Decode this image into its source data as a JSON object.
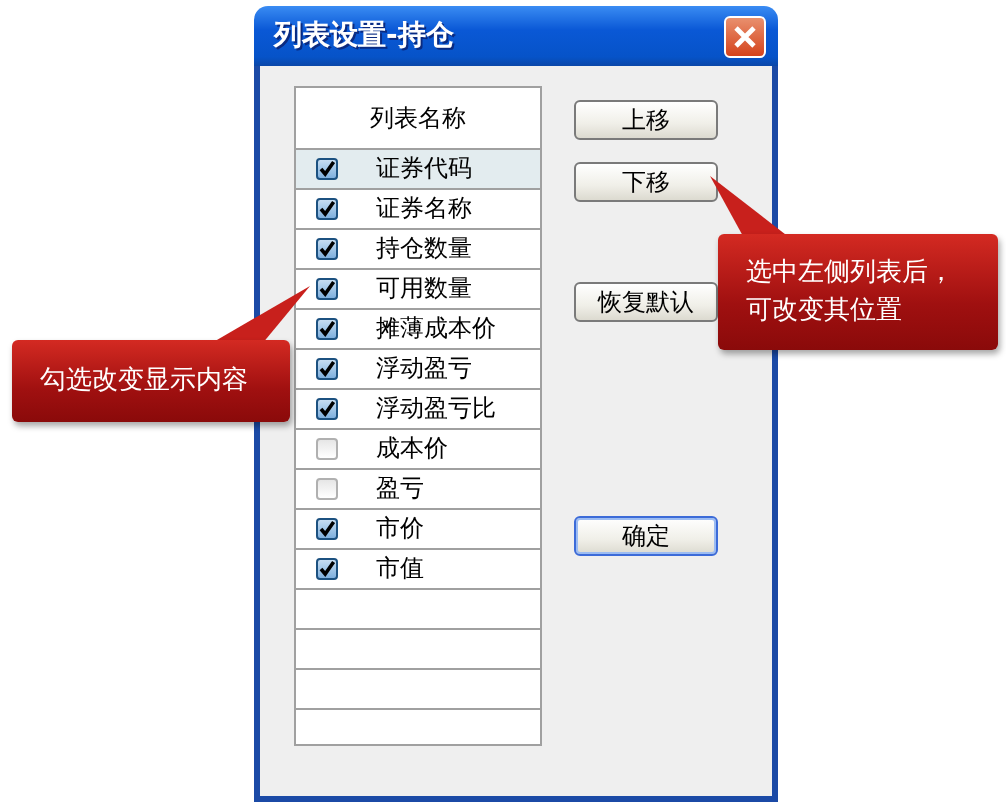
{
  "window": {
    "title": "列表设置-持仓"
  },
  "list": {
    "header": "列表名称",
    "items": [
      {
        "label": "证券代码",
        "checked": true,
        "selected": true
      },
      {
        "label": "证券名称",
        "checked": true,
        "selected": false
      },
      {
        "label": "持仓数量",
        "checked": true,
        "selected": false
      },
      {
        "label": "可用数量",
        "checked": true,
        "selected": false
      },
      {
        "label": "摊薄成本价",
        "checked": true,
        "selected": false
      },
      {
        "label": "浮动盈亏",
        "checked": true,
        "selected": false
      },
      {
        "label": "浮动盈亏比",
        "checked": true,
        "selected": false
      },
      {
        "label": "成本价",
        "checked": false,
        "selected": false
      },
      {
        "label": "盈亏",
        "checked": false,
        "selected": false
      },
      {
        "label": "市价",
        "checked": true,
        "selected": false
      },
      {
        "label": "市值",
        "checked": true,
        "selected": false
      }
    ]
  },
  "buttons": [
    {
      "label": "上移",
      "default": false
    },
    {
      "label": "下移",
      "default": false
    },
    {
      "label": "恢复默认",
      "default": false
    },
    {
      "label": "确定",
      "default": true
    }
  ],
  "callouts": [
    {
      "kind": "right",
      "lines": [
        "选中左侧列表后，",
        "可改变其位置"
      ]
    },
    {
      "kind": "left",
      "lines": [
        "勾选改变显示内容"
      ]
    }
  ]
}
